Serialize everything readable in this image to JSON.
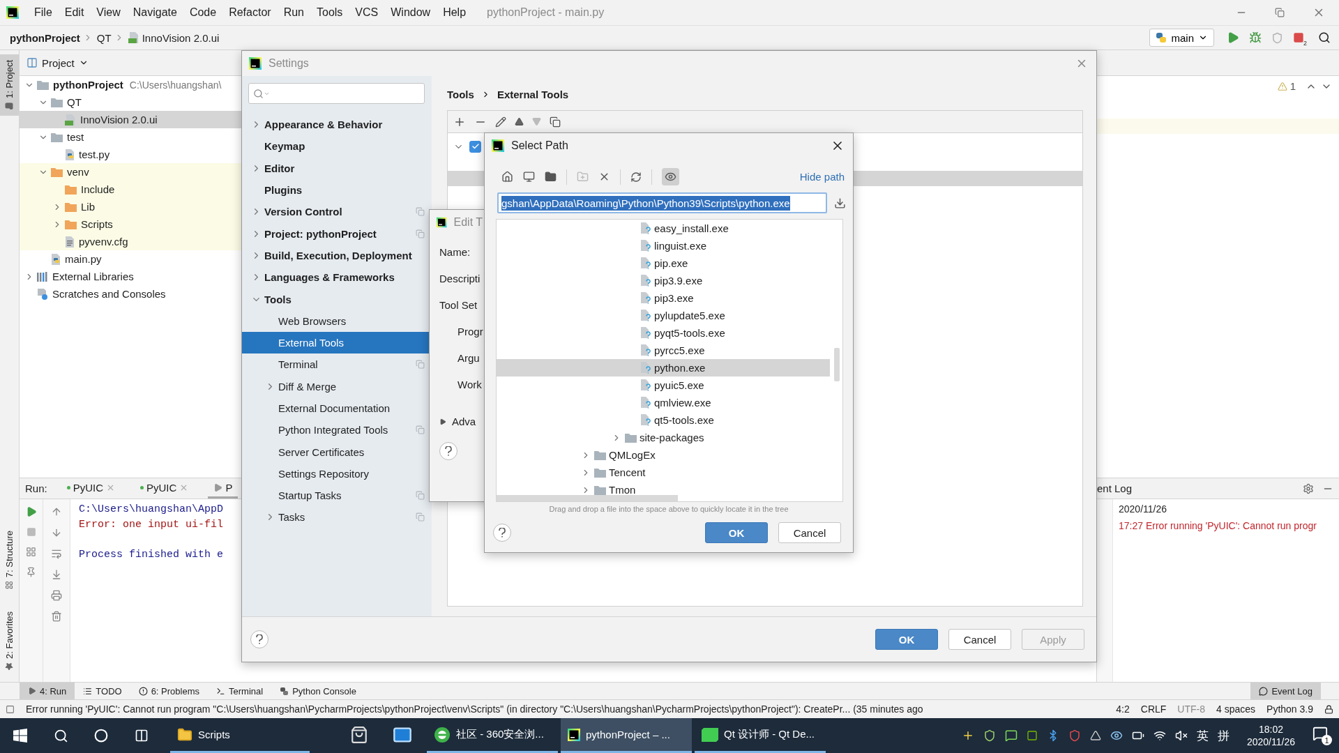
{
  "menu_bar": {
    "items": [
      "File",
      "Edit",
      "View",
      "Navigate",
      "Code",
      "Refactor",
      "Run",
      "Tools",
      "VCS",
      "Window",
      "Help"
    ],
    "title": "pythonProject - main.py"
  },
  "nav_bar": {
    "breadcrumb": [
      {
        "label": "pythonProject",
        "kind": "project"
      },
      {
        "label": "QT",
        "kind": "folder"
      },
      {
        "label": "InnoVision 2.0.ui",
        "kind": "qt"
      }
    ],
    "run_config": "main",
    "stop_badge": "2"
  },
  "side_stripe": {
    "top": [
      {
        "label": "1: Project",
        "selected": true
      }
    ],
    "bottom": [
      {
        "label": "7: Structure",
        "selected": false,
        "kind": "structure"
      },
      {
        "label": "2: Favorites",
        "selected": false,
        "kind": "favorites"
      }
    ]
  },
  "project_panel": {
    "title": "Project",
    "tree": [
      {
        "label": "pythonProject",
        "path": "C:\\Users\\huangshan\\",
        "kind": "module",
        "expanded": true,
        "selected": false,
        "excluded": false,
        "children": [
          {
            "label": "QT",
            "kind": "folder",
            "expanded": true,
            "selected": false,
            "excluded": false,
            "children": [
              {
                "label": "InnoVision 2.0.ui",
                "kind": "qt",
                "selected": true,
                "excluded": false
              }
            ]
          },
          {
            "label": "test",
            "kind": "folder",
            "expanded": true,
            "selected": false,
            "excluded": false,
            "children": [
              {
                "label": "test.py",
                "kind": "python",
                "selected": false,
                "excluded": false
              }
            ]
          },
          {
            "label": "venv",
            "kind": "folder",
            "expanded": true,
            "selected": false,
            "excluded": true,
            "children": [
              {
                "label": "Include",
                "kind": "folder",
                "selected": false,
                "excluded": true
              },
              {
                "label": "Lib",
                "kind": "folder",
                "expanded": false,
                "selected": false,
                "excluded": true
              },
              {
                "label": "Scripts",
                "kind": "folder",
                "expanded": false,
                "selected": false,
                "excluded": true
              },
              {
                "label": "pyvenv.cfg",
                "kind": "config",
                "selected": false,
                "excluded": true
              }
            ]
          },
          {
            "label": "main.py",
            "kind": "python",
            "selected": false,
            "excluded": false
          }
        ]
      },
      {
        "label": "External Libraries",
        "kind": "libraries",
        "expanded": false,
        "selected": false,
        "excluded": false
      },
      {
        "label": "Scratches and Consoles",
        "kind": "scratches",
        "selected": false,
        "excluded": false
      }
    ]
  },
  "editor": {
    "warning_count": "1"
  },
  "run_panel": {
    "label": "Run:",
    "tabs": [
      {
        "label": "PyUIC",
        "selected": false
      },
      {
        "label": "PyUIC",
        "selected": false
      },
      {
        "label": "P",
        "selected": true
      }
    ],
    "lines": [
      {
        "text": "C:\\Users\\huangshan\\AppD",
        "kind": "command"
      },
      {
        "text": "Error: one input ui-fil",
        "kind": "error"
      },
      {
        "text": "Process finished with e",
        "kind": "exit"
      }
    ]
  },
  "event_log": {
    "title": "ent Log",
    "date": "2020/11/26",
    "entries": [
      {
        "time": "17:27",
        "text": "Error running 'PyUIC': Cannot run progr"
      }
    ]
  },
  "tool_window_bar": {
    "tabs": [
      {
        "label": "4: Run",
        "kind": "run",
        "selected": true
      },
      {
        "label": "TODO",
        "kind": "todo",
        "selected": false
      },
      {
        "label": "6: Problems",
        "kind": "problems",
        "selected": false
      },
      {
        "label": "Terminal",
        "kind": "terminal",
        "selected": false
      },
      {
        "label": "Python Console",
        "kind": "console",
        "selected": false
      }
    ],
    "right_tabs": [
      {
        "label": "Event Log",
        "kind": "log",
        "selected": true
      }
    ]
  },
  "status_bar": {
    "message": "Error running 'PyUIC': Cannot run program \"C:\\Users\\huangshan\\PycharmProjects\\pythonProject\\venv\\Scripts\" (in directory \"C:\\Users\\huangshan\\PycharmProjects\\pythonProject\"): CreatePr... (35 minutes ago",
    "items": [
      {
        "label": "4:2",
        "disabled": false
      },
      {
        "label": "CRLF",
        "disabled": false
      },
      {
        "label": "UTF-8",
        "disabled": true
      },
      {
        "label": "4 spaces",
        "disabled": false
      },
      {
        "label": "Python 3.9",
        "disabled": false
      }
    ]
  },
  "settings": {
    "title": "Settings",
    "breadcrumb": [
      "Tools",
      "External Tools"
    ],
    "nav": [
      {
        "label": "Appearance & Behavior",
        "expanded": false,
        "selected": false,
        "project_level": false
      },
      {
        "label": "Keymap",
        "selected": false,
        "project_level": false
      },
      {
        "label": "Editor",
        "expanded": false,
        "selected": false,
        "project_level": false
      },
      {
        "label": "Plugins",
        "selected": false,
        "project_level": false
      },
      {
        "label": "Version Control",
        "expanded": false,
        "selected": false,
        "project_level": true
      },
      {
        "label": "Project: pythonProject",
        "expanded": false,
        "selected": false,
        "project_level": true
      },
      {
        "label": "Build, Execution, Deployment",
        "expanded": false,
        "selected": false,
        "project_level": false
      },
      {
        "label": "Languages & Frameworks",
        "expanded": false,
        "selected": false,
        "project_level": false
      },
      {
        "label": "Tools",
        "expanded": true,
        "selected": false,
        "project_level": false,
        "children": [
          {
            "label": "Web Browsers",
            "selected": false,
            "project_level": false
          },
          {
            "label": "External Tools",
            "selected": true,
            "project_level": false
          },
          {
            "label": "Terminal",
            "selected": false,
            "project_level": true
          },
          {
            "label": "Diff & Merge",
            "expanded": false,
            "selected": false,
            "project_level": false
          },
          {
            "label": "External Documentation",
            "selected": false,
            "project_level": false
          },
          {
            "label": "Python Integrated Tools",
            "selected": false,
            "project_level": true
          },
          {
            "label": "Server Certificates",
            "selected": false,
            "project_level": false
          },
          {
            "label": "Settings Repository",
            "selected": false,
            "project_level": false
          },
          {
            "label": "Startup Tasks",
            "selected": false,
            "project_level": true
          },
          {
            "label": "Tasks",
            "expanded": false,
            "selected": false,
            "project_level": true
          }
        ]
      }
    ],
    "tool_table": {
      "groups": [
        {
          "expanded": true,
          "checked": true,
          "tools": [
            {
              "selected": true
            }
          ]
        }
      ]
    },
    "buttons": [
      {
        "label": "OK",
        "kind": "primary",
        "disabled": false
      },
      {
        "label": "Cancel",
        "kind": "normal",
        "disabled": false
      },
      {
        "label": "Apply",
        "kind": "normal",
        "disabled": true
      }
    ]
  },
  "edit_tool": {
    "title": "Edit T",
    "fields": [
      {
        "label": "Name:",
        "kind": "field"
      },
      {
        "label": "Descripti",
        "kind": "field"
      },
      {
        "label": "Tool Set",
        "kind": "field"
      },
      {
        "label": "Progr",
        "kind": "sub"
      },
      {
        "label": "Argu",
        "kind": "sub"
      },
      {
        "label": "Work",
        "kind": "sub"
      }
    ],
    "advanced": {
      "label": "Adva",
      "expanded": false
    }
  },
  "select_path": {
    "title": "Select Path",
    "show_hidden": true,
    "hide_path_link": "Hide path",
    "path": "gshan\\AppData\\Roaming\\Python\\Python39\\Scripts\\python.exe",
    "tree": [
      {
        "children": [
          {
            "children": [
              {
                "children": [
                  {
                    "label": "easy_install.exe",
                    "kind": "file",
                    "selected": false
                  },
                  {
                    "label": "linguist.exe",
                    "kind": "file",
                    "selected": false
                  },
                  {
                    "label": "pip.exe",
                    "kind": "file",
                    "selected": false
                  },
                  {
                    "label": "pip3.9.exe",
                    "kind": "file",
                    "selected": false
                  },
                  {
                    "label": "pip3.exe",
                    "kind": "file",
                    "selected": false
                  },
                  {
                    "label": "pylupdate5.exe",
                    "kind": "file",
                    "selected": false
                  },
                  {
                    "label": "pyqt5-tools.exe",
                    "kind": "file",
                    "selected": false
                  },
                  {
                    "label": "pyrcc5.exe",
                    "kind": "file",
                    "selected": false
                  },
                  {
                    "label": "python.exe",
                    "kind": "file",
                    "selected": true
                  },
                  {
                    "label": "pyuic5.exe",
                    "kind": "file",
                    "selected": false
                  },
                  {
                    "label": "qmlview.exe",
                    "kind": "file",
                    "selected": false
                  },
                  {
                    "label": "qt5-tools.exe",
                    "kind": "file",
                    "selected": false
                  }
                ]
              },
              {
                "label": "site-packages",
                "kind": "folder",
                "expanded": false,
                "selected": false
              }
            ]
          }
        ]
      },
      {
        "label": "QMLogEx",
        "kind": "folder",
        "expanded": false,
        "selected": false
      },
      {
        "label": "Tencent",
        "kind": "folder",
        "expanded": false,
        "selected": false
      },
      {
        "label": "Tmon",
        "kind": "folder",
        "expanded": false,
        "selected": false
      }
    ],
    "hint": "Drag and drop a file into the space above to quickly locate it in the tree",
    "buttons": [
      {
        "label": "OK",
        "kind": "primary",
        "disabled": false
      },
      {
        "label": "Cancel",
        "kind": "normal",
        "disabled": false
      }
    ]
  },
  "taskbar": {
    "apps": [
      {
        "label": "Scripts",
        "kind": "explorer",
        "running": true,
        "selected": false
      },
      {
        "kind": "store",
        "running": false,
        "selected": false
      },
      {
        "kind": "mail",
        "running": false,
        "selected": false
      },
      {
        "label": "社区 - 360安全浏...",
        "kind": "browser",
        "running": true,
        "selected": false
      },
      {
        "label": "pythonProject – ...",
        "kind": "pycharm",
        "running": true,
        "selected": true
      },
      {
        "label": "Qt 设计师 - Qt De...",
        "kind": "designer",
        "running": true,
        "selected": false
      }
    ],
    "ime": "英",
    "ime_mode": "拼",
    "time": "18:02",
    "date": "2020/11/26",
    "notification_count": "1"
  }
}
